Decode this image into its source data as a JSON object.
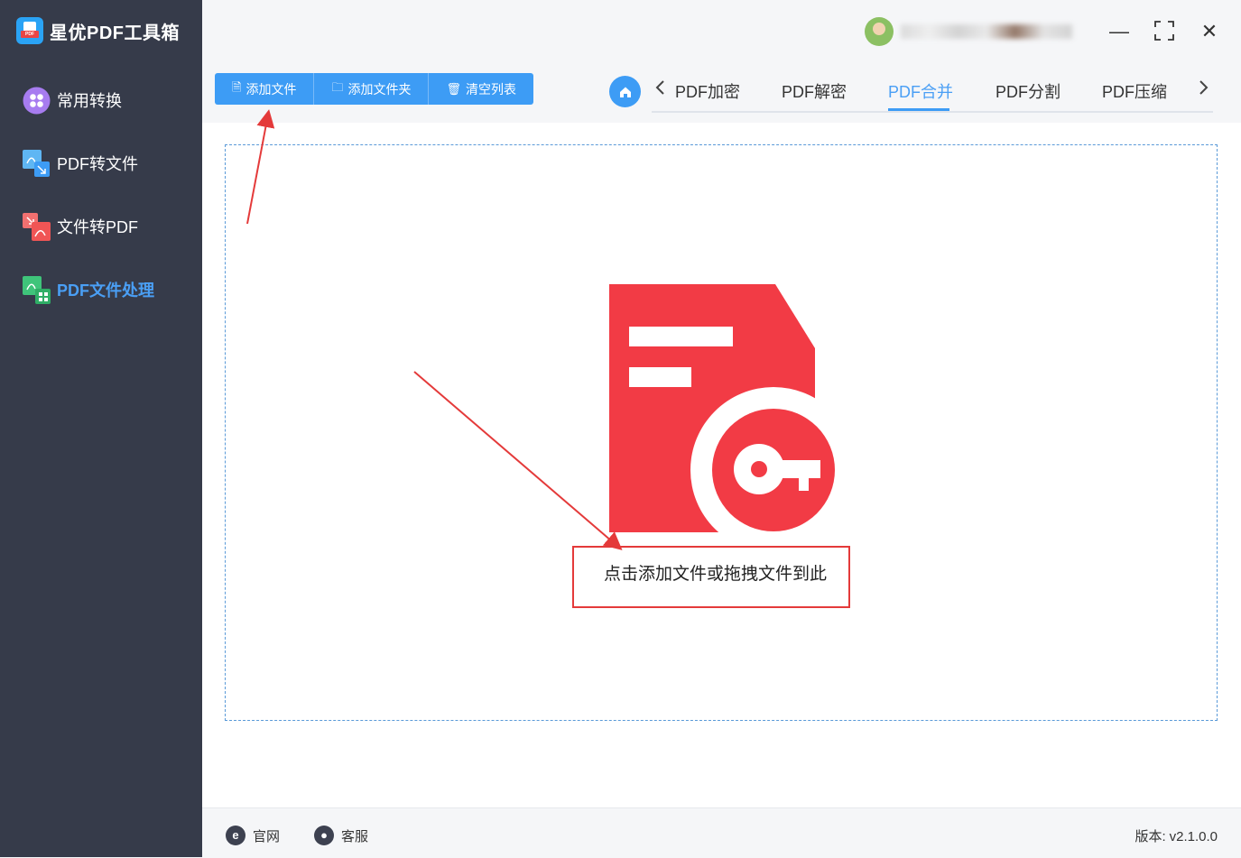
{
  "app": {
    "title": "星优PDF工具箱",
    "logo_tag": "PDF"
  },
  "sidebar": {
    "items": [
      {
        "label": "常用转换",
        "icon": "apps-icon",
        "active": false
      },
      {
        "label": "PDF转文件",
        "icon": "pdf-to-file-icon",
        "active": false
      },
      {
        "label": "文件转PDF",
        "icon": "file-to-pdf-icon",
        "active": false
      },
      {
        "label": "PDF文件处理",
        "icon": "pdf-process-icon",
        "active": true
      }
    ]
  },
  "toolbar": {
    "add_file": "添加文件",
    "add_folder": "添加文件夹",
    "clear_list": "清空列表"
  },
  "tabs": {
    "items": [
      "PDF加密",
      "PDF解密",
      "PDF合并",
      "PDF分割",
      "PDF压缩"
    ],
    "active": "PDF合并"
  },
  "window_controls": {
    "minimize": "—",
    "maximize": "⛶",
    "close": "✕"
  },
  "dropzone": {
    "hint": "点击添加文件或拖拽文件到此"
  },
  "footer": {
    "website": "官网",
    "support": "客服",
    "version_label": "版本:",
    "version_value": "v2.1.0.0"
  },
  "colors": {
    "sidebar_bg": "#363b4a",
    "accent": "#3d9cf5",
    "pdf_icon_red": "#f23b45",
    "annotation_red": "#e43a3a"
  }
}
